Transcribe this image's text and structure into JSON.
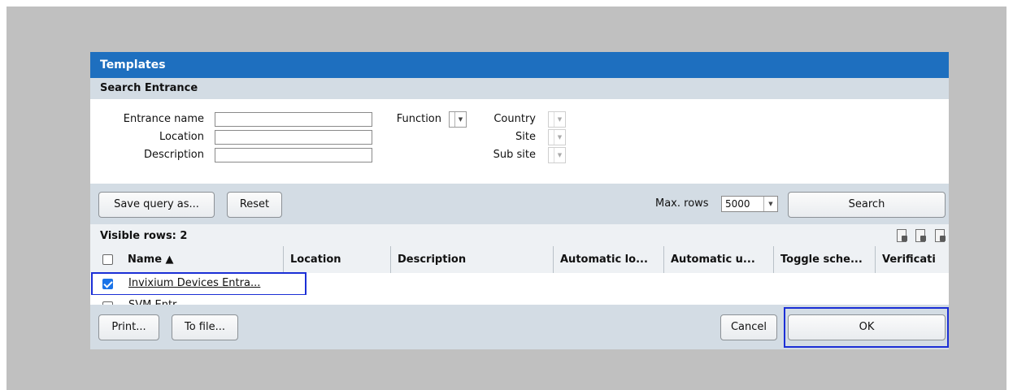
{
  "dialog": {
    "title": "Templates"
  },
  "search": {
    "heading": "Search Entrance",
    "entrance_name_label": "Entrance name",
    "entrance_name_value": "",
    "location_label": "Location",
    "location_value": "",
    "description_label": "Description",
    "description_value": "",
    "function_label": "Function",
    "country_label": "Country",
    "site_label": "Site",
    "sub_site_label": "Sub site"
  },
  "toolbar": {
    "save_query_label": "Save query as...",
    "reset_label": "Reset",
    "max_rows_label": "Max. rows",
    "max_rows_value": "5000",
    "search_label": "Search"
  },
  "results": {
    "visible_rows_label": "Visible rows: 2",
    "columns": [
      "Name ▲",
      "Location",
      "Description",
      "Automatic lo...",
      "Automatic u...",
      "Toggle sche...",
      "Verificati"
    ],
    "rows": [
      {
        "name": "Invixium Devices Entra...",
        "checked": true
      },
      {
        "name": "SVM Entr...",
        "checked": false
      }
    ]
  },
  "footer": {
    "print_label": "Print...",
    "to_file_label": "To file...",
    "cancel_label": "Cancel",
    "ok_label": "OK"
  },
  "colors": {
    "titlebar": "#1e6fbf",
    "section": "#d3dce4",
    "highlight": "#1b2fd6",
    "checkbox": "#1a73e8"
  },
  "icons": [
    "edit-document-icon",
    "export-document-icon",
    "check-document-icon"
  ]
}
